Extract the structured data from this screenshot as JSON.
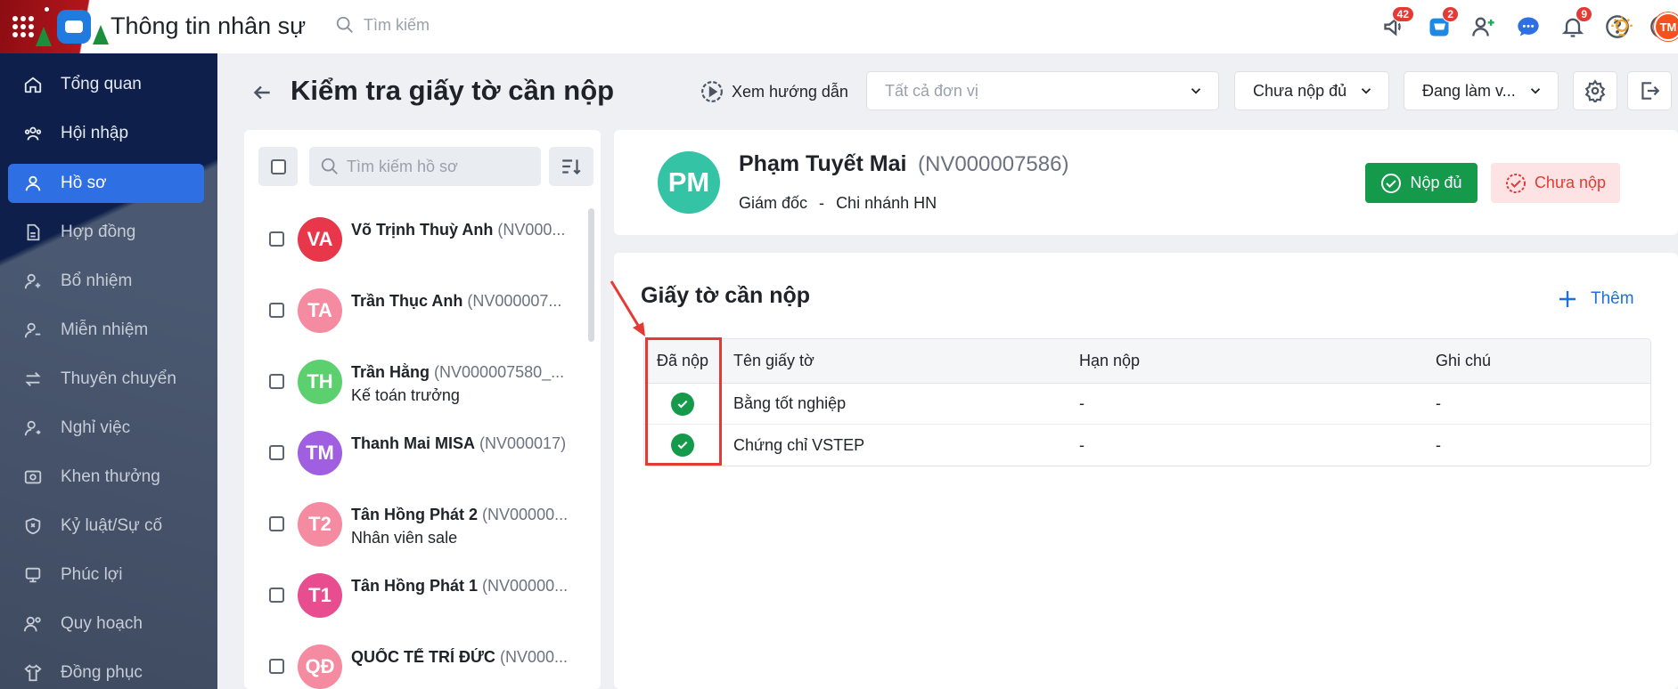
{
  "app": {
    "title": "Thông tin nhân sự",
    "search_placeholder": "Tìm kiếm"
  },
  "top_icons": [
    {
      "name": "megaphone-icon",
      "badge": "42"
    },
    {
      "name": "cart-icon",
      "badge": "2"
    },
    {
      "name": "add-user-icon",
      "badge": ""
    },
    {
      "name": "chat-icon",
      "badge": ""
    },
    {
      "name": "bell-icon",
      "badge": "9"
    },
    {
      "name": "help-icon",
      "badge": ""
    },
    {
      "name": "more-icon",
      "badge": ""
    },
    {
      "name": "lightbulb-icon",
      "badge": ""
    }
  ],
  "user_avatar": "TM",
  "sidebar": {
    "items": [
      {
        "label": "Tổng quan",
        "icon": "home-icon"
      },
      {
        "label": "Hội nhập",
        "icon": "team-icon"
      },
      {
        "label": "Hồ sơ",
        "icon": "user-icon",
        "active": true
      },
      {
        "label": "Hợp đồng",
        "icon": "document-icon"
      },
      {
        "label": "Bổ nhiệm",
        "icon": "user-plus-icon"
      },
      {
        "label": "Miễn nhiệm",
        "icon": "user-minus-icon"
      },
      {
        "label": "Thuyên chuyển",
        "icon": "transfer-icon"
      },
      {
        "label": "Nghỉ việc",
        "icon": "user-leave-icon"
      },
      {
        "label": "Khen thưởng",
        "icon": "reward-icon"
      },
      {
        "label": "Kỷ luật/Sự cố",
        "icon": "shield-icon"
      },
      {
        "label": "Phúc lợi",
        "icon": "benefit-icon"
      },
      {
        "label": "Quy hoạch",
        "icon": "planning-icon"
      },
      {
        "label": "Đồng phục",
        "icon": "shirt-icon"
      }
    ]
  },
  "header": {
    "title": "Kiểm tra giấy tờ cần nộp",
    "guide_label": "Xem hướng dẫn",
    "unit_placeholder": "Tất cả đơn vị",
    "status_filter": "Chưa nộp đủ",
    "work_filter": "Đang làm v..."
  },
  "list": {
    "search_placeholder": "Tìm kiếm hồ sơ",
    "employees": [
      {
        "initials": "VA",
        "name": "Võ Trịnh Thuỳ Anh",
        "code": "(NV000...",
        "sub": "",
        "color": "#e8364a"
      },
      {
        "initials": "TA",
        "name": "Trần Thục Anh",
        "code": "(NV000007...",
        "sub": "",
        "color": "#f48ba1"
      },
      {
        "initials": "TH",
        "name": "Trần Hằng",
        "code": "(NV000007580_...",
        "sub": "Kế toán trưởng",
        "color": "#5ccf6e"
      },
      {
        "initials": "TM",
        "name": "Thanh Mai MISA",
        "code": "(NV000017)",
        "sub": "",
        "color": "#a05fe0"
      },
      {
        "initials": "T2",
        "name": "Tân Hồng Phát 2",
        "code": "(NV00000...",
        "sub": "Nhân viên sale",
        "color": "#f48ba1"
      },
      {
        "initials": "T1",
        "name": "Tân Hồng Phát 1",
        "code": "(NV00000...",
        "sub": "",
        "color": "#e84d8f"
      },
      {
        "initials": "QĐ",
        "name": "QUỐC TẾ TRÍ ĐỨC",
        "code": "(NV000...",
        "sub": "",
        "color": "#f48ba1"
      }
    ]
  },
  "profile": {
    "initials": "PM",
    "name": "Phạm Tuyết Mai",
    "code": "(NV000007586)",
    "position": "Giám đốc",
    "separator": "-",
    "branch": "Chi nhánh HN",
    "btn_ok": "Nộp đủ",
    "btn_no": "Chưa nộp"
  },
  "docs": {
    "title": "Giấy tờ cần nộp",
    "add_label": "Thêm",
    "columns": [
      "Đã nộp",
      "Tên giấy tờ",
      "Hạn nộp",
      "Ghi chú"
    ],
    "rows": [
      {
        "name": "Bằng tốt nghiệp",
        "deadline": "-",
        "note": "-"
      },
      {
        "name": "Chứng chỉ VSTEP",
        "deadline": "-",
        "note": "-"
      }
    ]
  }
}
